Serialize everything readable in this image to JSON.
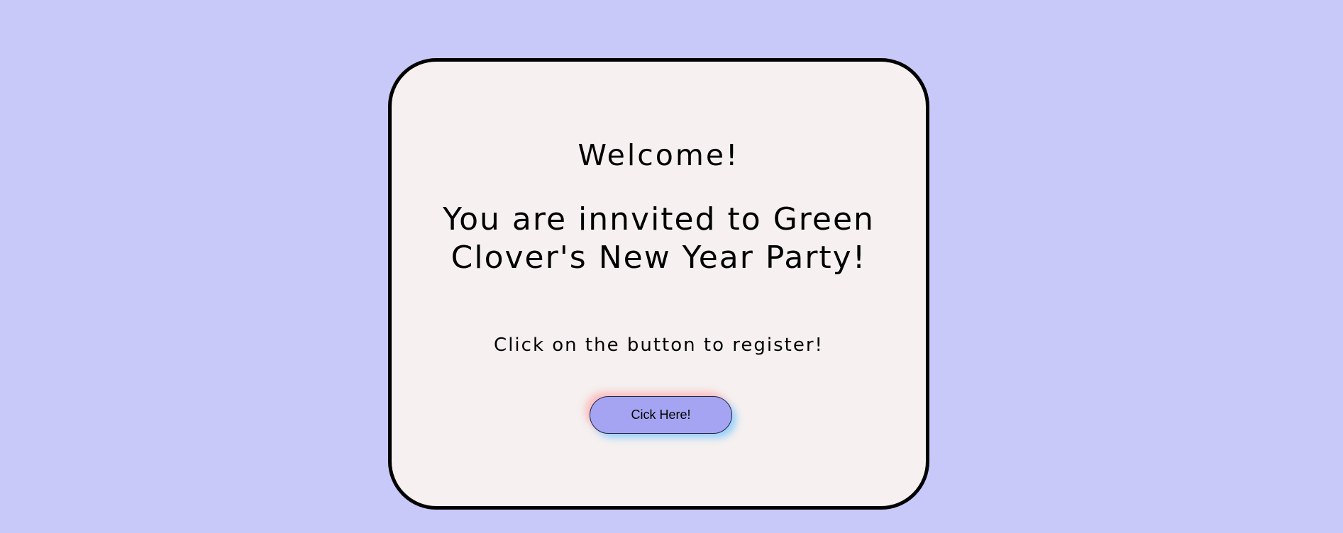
{
  "card": {
    "welcome": "Welcome!",
    "invitation": "You are innvited to Green Clover's New Year Party!",
    "instruction": "Click on the button to register!",
    "button_label": "Cick Here!"
  },
  "colors": {
    "page_background": "#c8c8f9",
    "card_background": "#f6f0f0",
    "card_border": "#000000",
    "button_background": "#a4a4f3"
  }
}
